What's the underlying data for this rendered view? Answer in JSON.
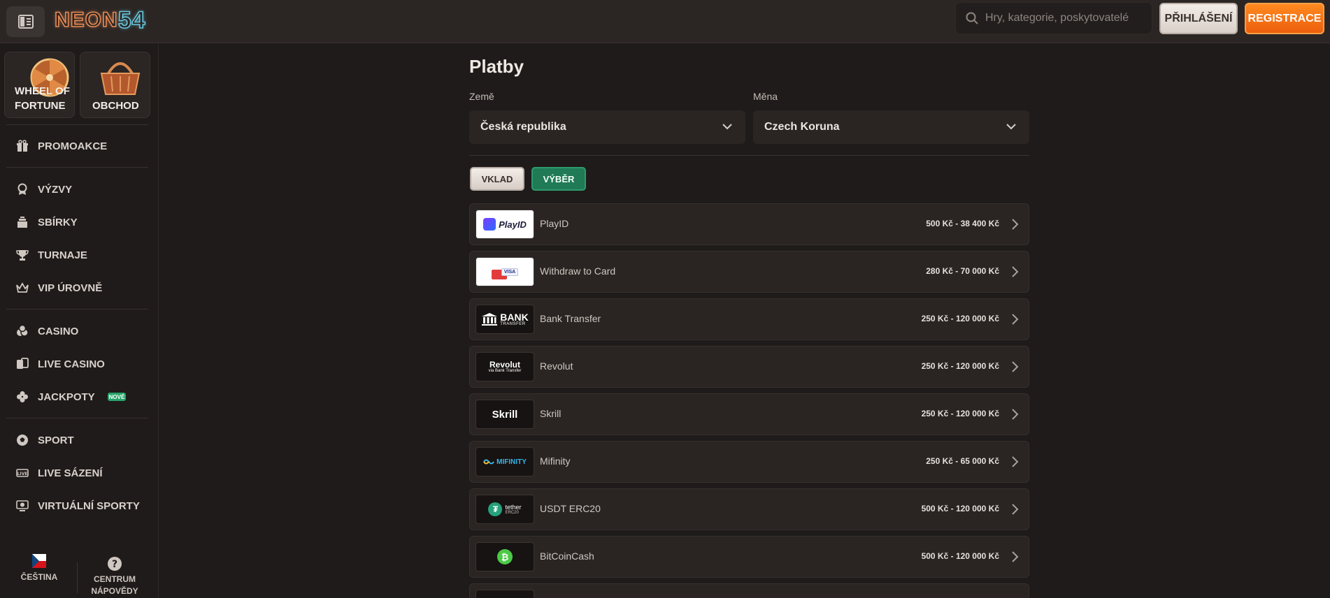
{
  "header": {
    "logo_text_1": "NEON",
    "logo_text_2": "54",
    "search_placeholder": "Hry, kategorie, poskytovatelé",
    "login_label": "PŘIHLÁŠENÍ",
    "register_label": "REGISTRACE"
  },
  "sidebar": {
    "promo_cards": [
      {
        "label_1": "WHEEL OF",
        "label_2": "FORTUNE",
        "icon": "wheel-of-fortune-icon"
      },
      {
        "label_1": "OBCHOD",
        "icon": "shopping-basket-icon"
      }
    ],
    "items": [
      {
        "label": "PROMOAKCE",
        "icon": "gift-icon"
      },
      {
        "label": "VÝZVY",
        "icon": "medal-icon"
      },
      {
        "label": "SBÍRKY",
        "icon": "collection-icon"
      },
      {
        "label": "TURNAJE",
        "icon": "trophy-icon"
      },
      {
        "label": "VIP ÚROVNĚ",
        "icon": "crown-icon"
      },
      {
        "label": "CASINO",
        "icon": "chips-icon"
      },
      {
        "label": "LIVE CASINO",
        "icon": "cards-icon"
      },
      {
        "label": "JACKPOTY",
        "icon": "clover-icon",
        "badge": "NOVÉ"
      },
      {
        "label": "SPORT",
        "icon": "soccer-ball-icon"
      },
      {
        "label": "LIVE SÁZENÍ",
        "icon": "live-icon"
      },
      {
        "label": "VIRTUÁLNÍ SPORTY",
        "icon": "virtual-sports-icon"
      }
    ],
    "footer": {
      "language_label": "ČEŠTINA",
      "help_label_1": "CENTRUM",
      "help_label_2": "NÁPOVĚDY"
    }
  },
  "main": {
    "title": "Platby",
    "country_label": "Země",
    "country_value": "Česká republika",
    "currency_label": "Měna",
    "currency_value": "Czech Koruna",
    "tabs": {
      "deposit": "VKLAD",
      "withdrawal": "VÝBĚR"
    },
    "methods": [
      {
        "name": "PlayID",
        "limit": "500 Kč - 38 400 Kč",
        "logo": "playid-logo"
      },
      {
        "name": "Withdraw to Card",
        "limit": "280 Kč - 70 000 Kč",
        "logo": "visa-card-logo"
      },
      {
        "name": "Bank Transfer",
        "limit": "250 Kč - 120 000 Kč",
        "logo": "bank-transfer-logo"
      },
      {
        "name": "Revolut",
        "limit": "250 Kč - 120 000 Kč",
        "logo": "revolut-logo"
      },
      {
        "name": "Skrill",
        "limit": "250 Kč - 120 000 Kč",
        "logo": "skrill-logo"
      },
      {
        "name": "Mifinity",
        "limit": "250 Kč - 65 000 Kč",
        "logo": "mifinity-logo"
      },
      {
        "name": "USDT ERC20",
        "limit": "500 Kč - 120 000 Kč",
        "logo": "tether-logo"
      },
      {
        "name": "BitCoinCash",
        "limit": "500 Kč - 120 000 Kč",
        "logo": "bitcoincash-logo"
      }
    ],
    "logo_texts": {
      "playid": "PlayID",
      "visa": "VISA",
      "bank_1": "BANK",
      "bank_2": "TRANSFER",
      "revolut_1": "Revolut",
      "revolut_2": "via Bank Transfer",
      "skrill": "Skrill",
      "mifinity": "MIFINITY",
      "tether_1": "tether",
      "tether_2": "ERC20"
    }
  },
  "colors": {
    "accent_orange": "#ec5f0c",
    "accent_green": "#1f7a55",
    "background": "#1e1b1a",
    "panel": "#2a2523"
  }
}
